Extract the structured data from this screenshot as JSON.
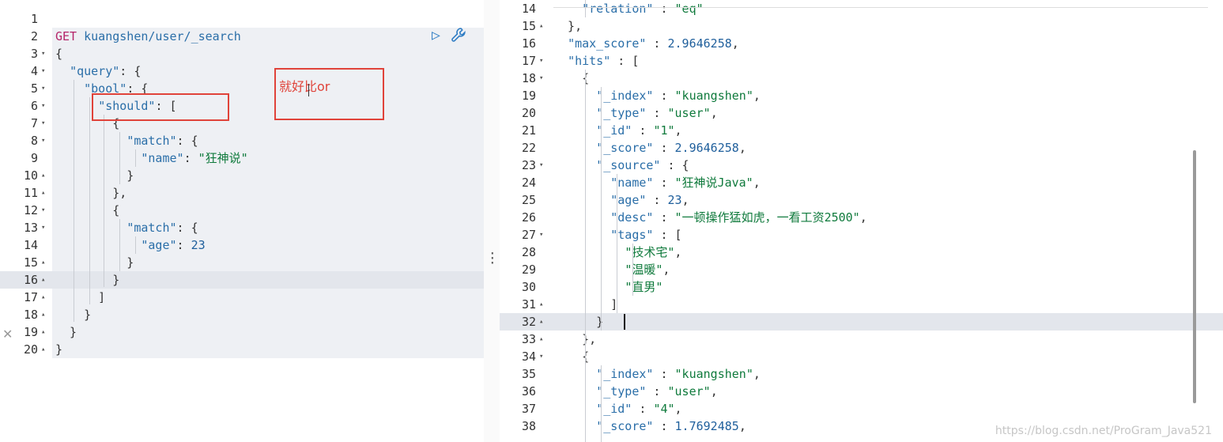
{
  "left_editor": {
    "request_method": "GET",
    "request_path": "kuangshen/user/_search",
    "run_icon": "play-icon",
    "settings_icon": "wrench-icon",
    "annotation_text": "就好比or",
    "lines": [
      {
        "n": "1",
        "fold": "",
        "t": []
      },
      {
        "n": "2",
        "fold": "",
        "t": [
          [
            "m",
            "GET"
          ],
          [
            "p",
            " "
          ],
          [
            "k",
            "kuangshen/user/_search"
          ]
        ]
      },
      {
        "n": "3",
        "fold": "▾",
        "t": [
          [
            "p",
            "{"
          ]
        ]
      },
      {
        "n": "4",
        "fold": "▾",
        "t": [
          [
            "p",
            "  "
          ],
          [
            "k",
            "\"query\""
          ],
          [
            "p",
            ": {"
          ]
        ]
      },
      {
        "n": "5",
        "fold": "▾",
        "t": [
          [
            "p",
            "    "
          ],
          [
            "k",
            "\"bool\""
          ],
          [
            "p",
            ": {"
          ]
        ]
      },
      {
        "n": "6",
        "fold": "▾",
        "t": [
          [
            "p",
            "      "
          ],
          [
            "k",
            "\"should\""
          ],
          [
            "p",
            ": ["
          ]
        ]
      },
      {
        "n": "7",
        "fold": "▾",
        "t": [
          [
            "p",
            "        {"
          ]
        ]
      },
      {
        "n": "8",
        "fold": "▾",
        "t": [
          [
            "p",
            "          "
          ],
          [
            "k",
            "\"match\""
          ],
          [
            "p",
            ": {"
          ]
        ]
      },
      {
        "n": "9",
        "fold": "",
        "t": [
          [
            "p",
            "            "
          ],
          [
            "k",
            "\"name\""
          ],
          [
            "p",
            ": "
          ],
          [
            "s",
            "\"狂神说\""
          ]
        ]
      },
      {
        "n": "10",
        "fold": "▴",
        "t": [
          [
            "p",
            "          }"
          ]
        ]
      },
      {
        "n": "11",
        "fold": "▴",
        "t": [
          [
            "p",
            "        },"
          ]
        ]
      },
      {
        "n": "12",
        "fold": "▾",
        "t": [
          [
            "p",
            "        {"
          ]
        ]
      },
      {
        "n": "13",
        "fold": "▾",
        "t": [
          [
            "p",
            "          "
          ],
          [
            "k",
            "\"match\""
          ],
          [
            "p",
            ": {"
          ]
        ]
      },
      {
        "n": "14",
        "fold": "",
        "t": [
          [
            "p",
            "            "
          ],
          [
            "k",
            "\"age\""
          ],
          [
            "p",
            ": "
          ],
          [
            "n",
            "23"
          ]
        ]
      },
      {
        "n": "15",
        "fold": "▴",
        "t": [
          [
            "p",
            "          }"
          ]
        ]
      },
      {
        "n": "16",
        "fold": "▴",
        "t": [
          [
            "p",
            "        }"
          ]
        ]
      },
      {
        "n": "17",
        "fold": "▴",
        "t": [
          [
            "p",
            "      ]"
          ]
        ]
      },
      {
        "n": "18",
        "fold": "▴",
        "t": [
          [
            "p",
            "    }"
          ]
        ]
      },
      {
        "n": "19",
        "fold": "▴",
        "t": [
          [
            "p",
            "  }"
          ]
        ]
      },
      {
        "n": "20",
        "fold": "▴",
        "t": [
          [
            "p",
            "}"
          ]
        ]
      }
    ]
  },
  "right_editor": {
    "lines": [
      {
        "n": "14",
        "fold": "",
        "t": [
          [
            "p",
            "    "
          ],
          [
            "k",
            "\"relation\""
          ],
          [
            "p",
            " : "
          ],
          [
            "s",
            "\"eq\""
          ]
        ]
      },
      {
        "n": "15",
        "fold": "▴",
        "t": [
          [
            "p",
            "  },"
          ]
        ]
      },
      {
        "n": "16",
        "fold": "",
        "t": [
          [
            "p",
            "  "
          ],
          [
            "k",
            "\"max_score\""
          ],
          [
            "p",
            " : "
          ],
          [
            "n",
            "2.9646258"
          ],
          [
            "p",
            ","
          ]
        ]
      },
      {
        "n": "17",
        "fold": "▾",
        "t": [
          [
            "p",
            "  "
          ],
          [
            "k",
            "\"hits\""
          ],
          [
            "p",
            " : ["
          ]
        ]
      },
      {
        "n": "18",
        "fold": "▾",
        "t": [
          [
            "p",
            "    {"
          ]
        ]
      },
      {
        "n": "19",
        "fold": "",
        "t": [
          [
            "p",
            "      "
          ],
          [
            "k",
            "\"_index\""
          ],
          [
            "p",
            " : "
          ],
          [
            "s",
            "\"kuangshen\""
          ],
          [
            "p",
            ","
          ]
        ]
      },
      {
        "n": "20",
        "fold": "",
        "t": [
          [
            "p",
            "      "
          ],
          [
            "k",
            "\"_type\""
          ],
          [
            "p",
            " : "
          ],
          [
            "s",
            "\"user\""
          ],
          [
            "p",
            ","
          ]
        ]
      },
      {
        "n": "21",
        "fold": "",
        "t": [
          [
            "p",
            "      "
          ],
          [
            "k",
            "\"_id\""
          ],
          [
            "p",
            " : "
          ],
          [
            "s",
            "\"1\""
          ],
          [
            "p",
            ","
          ]
        ]
      },
      {
        "n": "22",
        "fold": "",
        "t": [
          [
            "p",
            "      "
          ],
          [
            "k",
            "\"_score\""
          ],
          [
            "p",
            " : "
          ],
          [
            "n",
            "2.9646258"
          ],
          [
            "p",
            ","
          ]
        ]
      },
      {
        "n": "23",
        "fold": "▾",
        "t": [
          [
            "p",
            "      "
          ],
          [
            "k",
            "\"_source\""
          ],
          [
            "p",
            " : {"
          ]
        ]
      },
      {
        "n": "24",
        "fold": "",
        "t": [
          [
            "p",
            "        "
          ],
          [
            "k",
            "\"name\""
          ],
          [
            "p",
            " : "
          ],
          [
            "s",
            "\"狂神说Java\""
          ],
          [
            "p",
            ","
          ]
        ]
      },
      {
        "n": "25",
        "fold": "",
        "t": [
          [
            "p",
            "        "
          ],
          [
            "k",
            "\"age\""
          ],
          [
            "p",
            " : "
          ],
          [
            "n",
            "23"
          ],
          [
            "p",
            ","
          ]
        ]
      },
      {
        "n": "26",
        "fold": "",
        "t": [
          [
            "p",
            "        "
          ],
          [
            "k",
            "\"desc\""
          ],
          [
            "p",
            " : "
          ],
          [
            "s",
            "\"一顿操作猛如虎，一看工资2500\""
          ],
          [
            "p",
            ","
          ]
        ]
      },
      {
        "n": "27",
        "fold": "▾",
        "t": [
          [
            "p",
            "        "
          ],
          [
            "k",
            "\"tags\""
          ],
          [
            "p",
            " : ["
          ]
        ]
      },
      {
        "n": "28",
        "fold": "",
        "t": [
          [
            "p",
            "          "
          ],
          [
            "s",
            "\"技术宅\""
          ],
          [
            "p",
            ","
          ]
        ]
      },
      {
        "n": "29",
        "fold": "",
        "t": [
          [
            "p",
            "          "
          ],
          [
            "s",
            "\"温暖\""
          ],
          [
            "p",
            ","
          ]
        ]
      },
      {
        "n": "30",
        "fold": "",
        "t": [
          [
            "p",
            "          "
          ],
          [
            "s",
            "\"直男\""
          ]
        ]
      },
      {
        "n": "31",
        "fold": "▴",
        "t": [
          [
            "p",
            "        ]"
          ]
        ]
      },
      {
        "n": "32",
        "fold": "▴",
        "t": [
          [
            "p",
            "      }"
          ]
        ]
      },
      {
        "n": "33",
        "fold": "▴",
        "t": [
          [
            "p",
            "    },"
          ]
        ]
      },
      {
        "n": "34",
        "fold": "▾",
        "t": [
          [
            "p",
            "    {"
          ]
        ]
      },
      {
        "n": "35",
        "fold": "",
        "t": [
          [
            "p",
            "      "
          ],
          [
            "k",
            "\"_index\""
          ],
          [
            "p",
            " : "
          ],
          [
            "s",
            "\"kuangshen\""
          ],
          [
            "p",
            ","
          ]
        ]
      },
      {
        "n": "36",
        "fold": "",
        "t": [
          [
            "p",
            "      "
          ],
          [
            "k",
            "\"_type\""
          ],
          [
            "p",
            " : "
          ],
          [
            "s",
            "\"user\""
          ],
          [
            "p",
            ","
          ]
        ]
      },
      {
        "n": "37",
        "fold": "",
        "t": [
          [
            "p",
            "      "
          ],
          [
            "k",
            "\"_id\""
          ],
          [
            "p",
            " : "
          ],
          [
            "s",
            "\"4\""
          ],
          [
            "p",
            ","
          ]
        ]
      },
      {
        "n": "38",
        "fold": "",
        "t": [
          [
            "p",
            "      "
          ],
          [
            "k",
            "\"_score\""
          ],
          [
            "p",
            " : "
          ],
          [
            "n",
            "1.7692485"
          ],
          [
            "p",
            ","
          ]
        ]
      }
    ]
  },
  "watermark": "https://blog.csdn.net/ProGram_Java521",
  "close_icon": "close-icon"
}
